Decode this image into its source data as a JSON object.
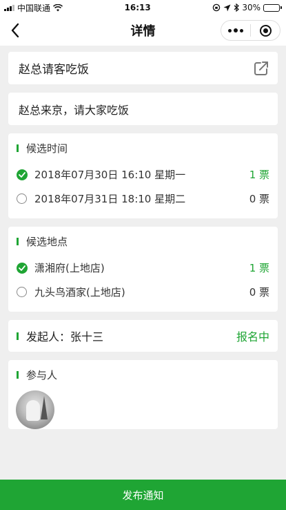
{
  "status_bar": {
    "carrier": "中国联通",
    "time": "16:13",
    "battery": "30%",
    "battery_level": 0.3
  },
  "nav": {
    "title": "详情",
    "back_icon": "back-arrow-icon",
    "menu_icon": "more-dots-icon",
    "close_icon": "target-circle-icon"
  },
  "event": {
    "title": "赵总请客吃饭",
    "description": "赵总来京，请大家吃饭"
  },
  "time_section": {
    "heading": "候选时间",
    "options": [
      {
        "label": "2018年07月30日 16:10 星期一",
        "votes": "1 票",
        "selected": true
      },
      {
        "label": "2018年07月31日 18:10 星期二",
        "votes": "0 票",
        "selected": false
      }
    ]
  },
  "place_section": {
    "heading": "候选地点",
    "options": [
      {
        "label": "潇湘府(上地店)",
        "votes": "1 票",
        "selected": true
      },
      {
        "label": "九头鸟酒家(上地店)",
        "votes": "0 票",
        "selected": false
      }
    ]
  },
  "initiator": {
    "label": "发起人：张十三",
    "status": "报名中"
  },
  "participants": {
    "heading": "参与人"
  },
  "bottom_button": {
    "label": "发布通知"
  },
  "colors": {
    "accent": "#1fa534",
    "background": "#efefef",
    "card": "#ffffff"
  }
}
